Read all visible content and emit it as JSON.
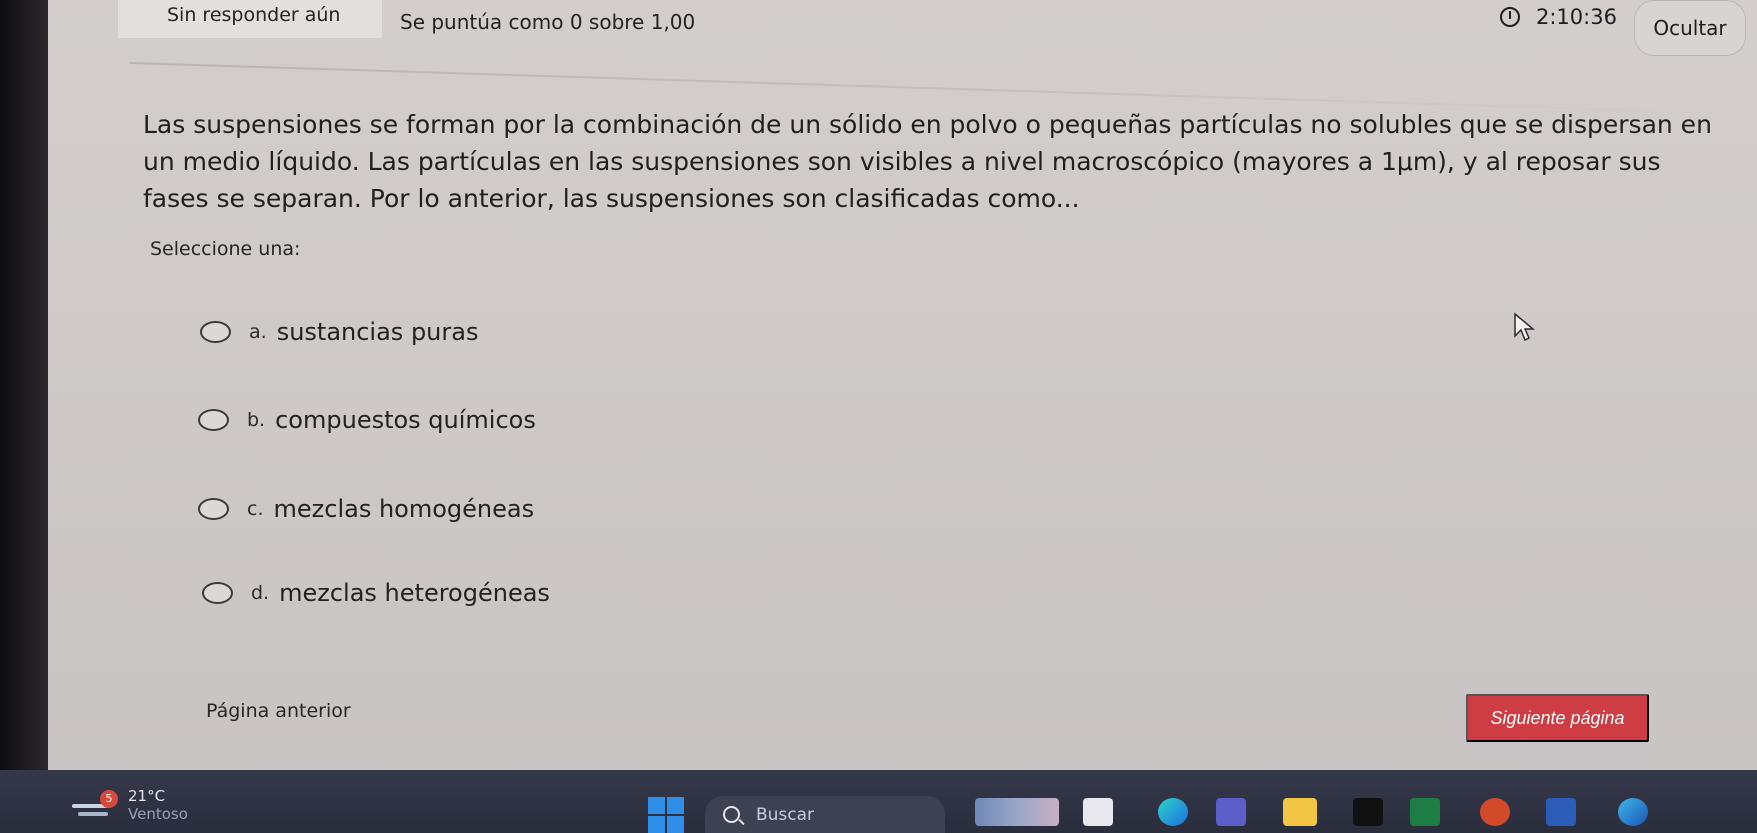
{
  "header": {
    "status": "Sin responder aún",
    "grade": "Se puntúa como 0 sobre 1,00",
    "timer": "2:10:36",
    "hide_label": "Ocultar"
  },
  "question": {
    "text": "Las suspensiones se forman por la combinación de un sólido en polvo o pequeñas partículas no solubles que se dispersan en un medio líquido. Las partículas en las suspensiones son visibles a nivel macroscópico (mayores a 1μm), y al reposar sus fases se separan. Por lo anterior, las suspensiones son clasificadas como...",
    "prompt": "Seleccione una:",
    "options": [
      {
        "letter": "a.",
        "label": "sustancias puras"
      },
      {
        "letter": "b.",
        "label": "compuestos químicos"
      },
      {
        "letter": "c.",
        "label": "mezclas homogéneas"
      },
      {
        "letter": "d.",
        "label": "mezclas heterogéneas"
      }
    ]
  },
  "navigation": {
    "prev_label": "Página anterior",
    "next_label": "Siguiente página"
  },
  "colors": {
    "next_button": "#ce3d43",
    "page_background": "#cfcac9",
    "taskbar": "#2a2d3c"
  },
  "taskbar": {
    "weather_badge": "5",
    "weather_temp": "21°C",
    "weather_desc": "Ventoso",
    "search_placeholder": "Buscar",
    "icons": [
      "windows-start-icon",
      "search-icon",
      "widgets-icon",
      "files-icon",
      "edge-icon",
      "teams-icon",
      "explorer-icon",
      "tiktok-icon",
      "excel-icon",
      "powerpoint-icon",
      "word-icon",
      "browser-icon"
    ]
  }
}
